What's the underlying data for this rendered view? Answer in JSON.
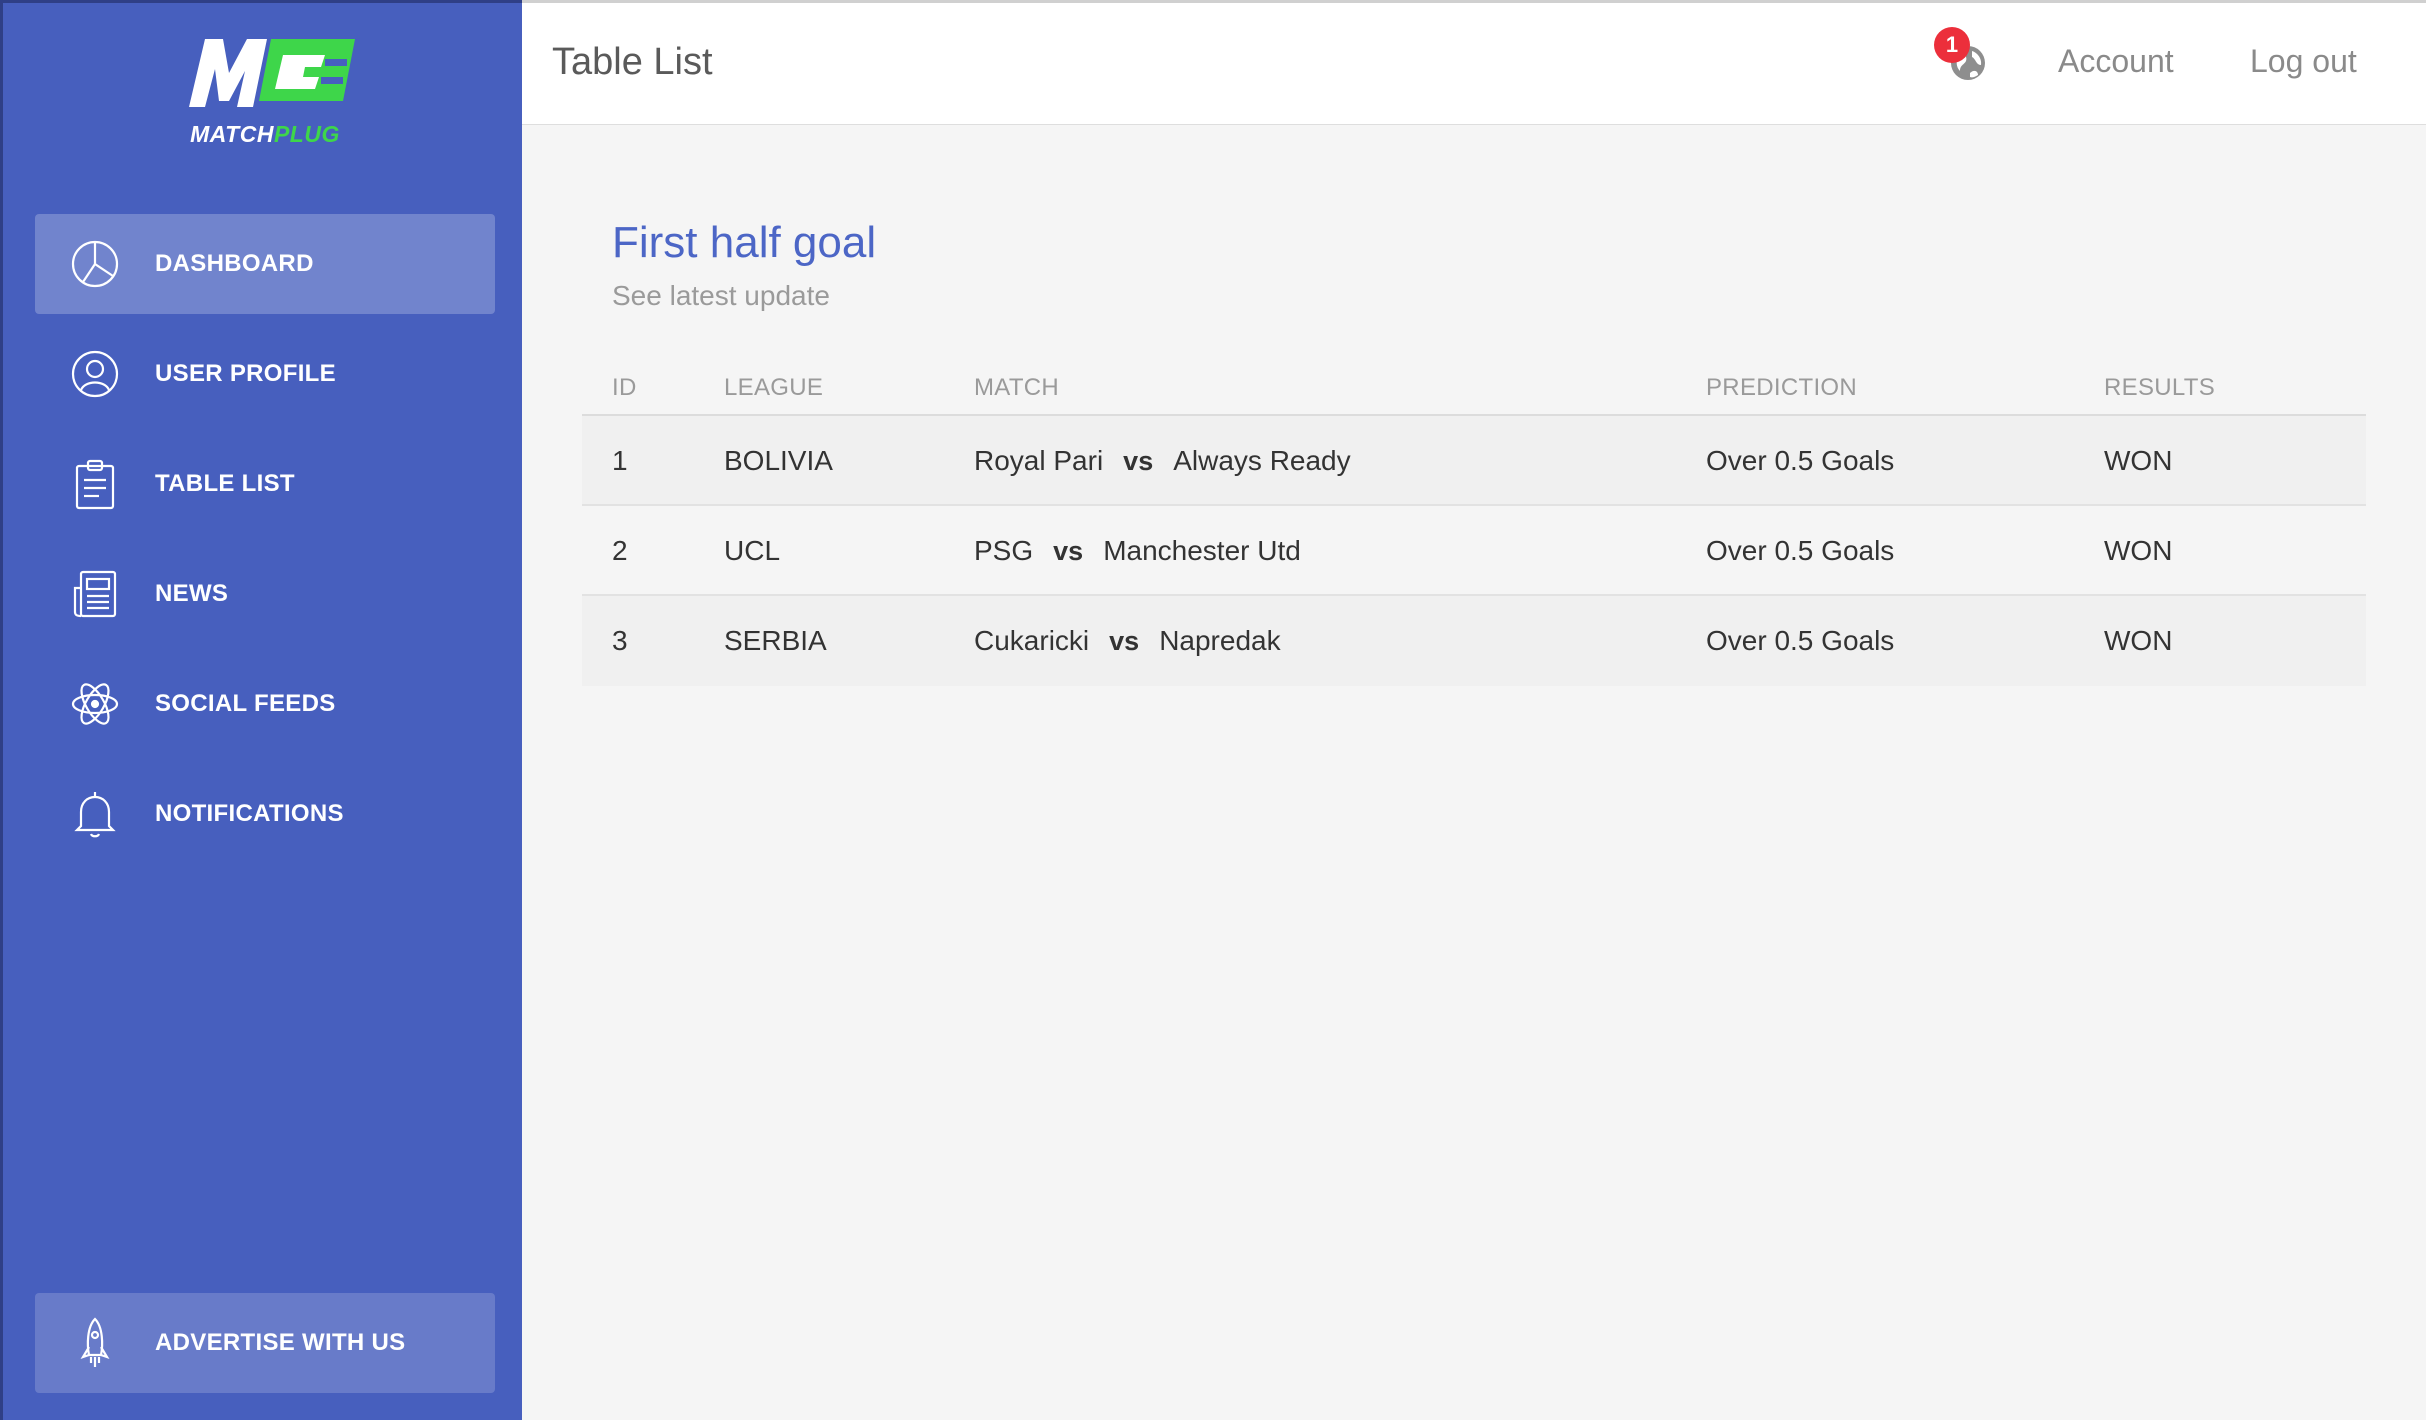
{
  "brand": {
    "logo_mark": "MP",
    "word_part1": "MATCH",
    "word_part2": "PLUG",
    "color_white": "#ffffff",
    "color_green": "#3ed64a"
  },
  "sidebar": {
    "bg_color": "#475fbe",
    "items": [
      {
        "label": "DASHBOARD",
        "icon": "pie-chart-icon",
        "active": true
      },
      {
        "label": "USER PROFILE",
        "icon": "user-icon",
        "active": false
      },
      {
        "label": "TABLE LIST",
        "icon": "clipboard-icon",
        "active": false
      },
      {
        "label": "NEWS",
        "icon": "newspaper-icon",
        "active": false
      },
      {
        "label": "SOCIAL FEEDS",
        "icon": "atom-icon",
        "active": false
      },
      {
        "label": "NOTIFICATIONS",
        "icon": "bell-icon",
        "active": false
      }
    ],
    "footer": {
      "label": "ADVERTISE WITH US",
      "icon": "rocket-icon"
    }
  },
  "header": {
    "title": "Table List",
    "notification_count": "1",
    "notification_icon": "globe-icon",
    "account_label": "Account",
    "logout_label": "Log out",
    "badge_color": "#ec2f3b"
  },
  "card": {
    "title": "First half goal",
    "subtitle": "See latest update",
    "title_color": "#4c66c6"
  },
  "table": {
    "columns": [
      "ID",
      "LEAGUE",
      "MATCH",
      "PREDICTION",
      "RESULTS"
    ],
    "rows": [
      {
        "id": "1",
        "league": "BOLIVIA",
        "home": "Royal Pari",
        "vs": "vs",
        "away": "Always Ready",
        "prediction": "Over 0.5 Goals",
        "result": "WON"
      },
      {
        "id": "2",
        "league": "UCL",
        "home": "PSG",
        "vs": "vs",
        "away": "Manchester Utd",
        "prediction": "Over 0.5 Goals",
        "result": "WON"
      },
      {
        "id": "3",
        "league": "SERBIA",
        "home": "Cukaricki",
        "vs": "vs",
        "away": "Napredak",
        "prediction": "Over 0.5 Goals",
        "result": "WON"
      }
    ]
  }
}
